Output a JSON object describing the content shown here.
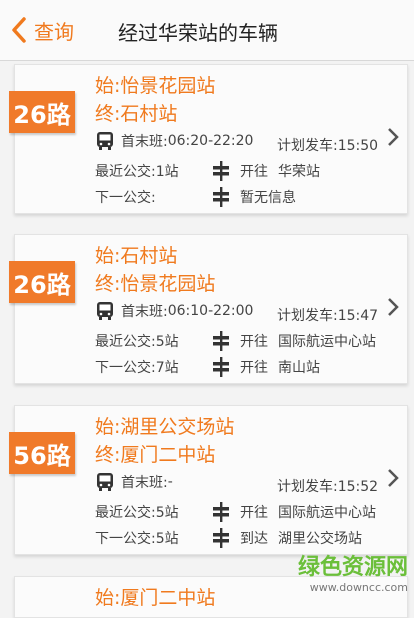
{
  "header": {
    "back_label": "查询",
    "title": "经过华荣站的车辆"
  },
  "labels": {
    "first_last": "首末班:",
    "planned": "计划发车:",
    "nearest": "最近公交:",
    "next": "下一公交:"
  },
  "cards": [
    {
      "route": "26路",
      "start": "始:怡景花园站",
      "end": "终:石村站",
      "hours": "06:20-22:20",
      "planned_time": "15:50",
      "nearest_stops": "1站",
      "nearest_status": "开往",
      "nearest_dest": "华荣站",
      "next_stops": "",
      "next_status": "暂无信息",
      "next_dest": ""
    },
    {
      "route": "26路",
      "start": "始:石村站",
      "end": "终:怡景花园站",
      "hours": "06:10-22:00",
      "planned_time": "15:47",
      "nearest_stops": "5站",
      "nearest_status": "开往",
      "nearest_dest": "国际航运中心站",
      "next_stops": "7站",
      "next_status": "开往",
      "next_dest": "南山站"
    },
    {
      "route": "56路",
      "start": "始:湖里公交场站",
      "end": "终:厦门二中站",
      "hours": "-",
      "planned_time": "15:52",
      "nearest_stops": "5站",
      "nearest_status": "开往",
      "nearest_dest": "国际航运中心站",
      "next_stops": "5站",
      "next_status": "到达",
      "next_dest": "湖里公交场站"
    },
    {
      "route": "",
      "start": "始:厦门二中站"
    }
  ],
  "watermark": {
    "line1": "绿色资源网",
    "line2": "www.downcc.com"
  },
  "colors": {
    "accent": "#f07a2a",
    "watermark": "#6bbf3a"
  },
  "icons": [
    "chevron-left-icon",
    "bus-icon",
    "bus-stop-sign-icon",
    "chevron-right-icon"
  ]
}
